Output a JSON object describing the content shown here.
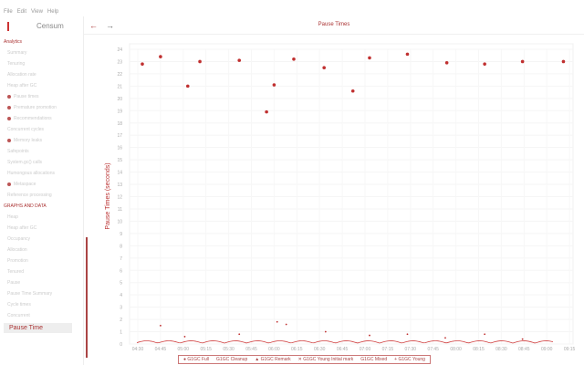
{
  "menu": [
    "File",
    "Edit",
    "View",
    "Help"
  ],
  "sidebar": {
    "brand": "Censum",
    "section1": "Analytics",
    "items1": [
      "Summary",
      "Tenuring",
      "Allocation rate",
      "Heap after GC",
      "Pause times",
      "Premature promotion",
      "Recommendations",
      "Concurrent cycles",
      "Memory leaks",
      "Safepoints",
      "System.gc() calls",
      "Humongous allocations",
      "Metaspace",
      "Reference processing"
    ],
    "section2": "GRAPHS AND DATA",
    "items2": [
      "Heap",
      "Heap after GC",
      "Occupancy",
      "Allocation",
      "Promotion",
      "Tenured",
      "Pause",
      "Pause Time Summary",
      "Cycle times",
      "Concurrent"
    ],
    "selected": "Pause Time"
  },
  "toolbar": {
    "back": "←",
    "forward": "→"
  },
  "chart_data": {
    "type": "scatter",
    "title": "Pause Times",
    "xlabel": "",
    "ylabel": "Pause Times (seconds)",
    "ylim": [
      0,
      24
    ],
    "yticks": [
      0,
      1,
      2,
      3,
      4,
      5,
      6,
      7,
      8,
      9,
      10,
      11,
      12,
      13,
      14,
      15,
      16,
      17,
      18,
      19,
      20,
      21,
      22,
      23,
      24
    ],
    "xticks": [
      "04:30",
      "04:45",
      "05:00",
      "05:15",
      "05:30",
      "05:45",
      "06:00",
      "06:15",
      "06:30",
      "06:45",
      "07:00",
      "07:15",
      "07:30",
      "07:45",
      "08:00",
      "08:15",
      "08:30",
      "08:45",
      "09:00",
      "09:15"
    ],
    "xlim_minutes": [
      270,
      555
    ],
    "legend": [
      "G1GC Full",
      "G1GC Cleanup",
      "G1GC Remark",
      "G1GC Young Initial mark",
      "G1GC Mixed",
      "G1GC Young"
    ],
    "series": [
      {
        "name": "G1GC Full",
        "color": "#c03030",
        "x": [
          273,
          285,
          303,
          311,
          337,
          355,
          360,
          373,
          393,
          412,
          423,
          448,
          474,
          499,
          524,
          551
        ],
        "y": [
          22.8,
          23.4,
          21.0,
          23.0,
          23.1,
          18.9,
          21.1,
          23.2,
          22.5,
          20.6,
          23.3,
          23.6,
          22.9,
          22.8,
          23.0,
          23.0
        ]
      },
      {
        "name": "G1GC Remark",
        "color": "#c03030",
        "x": [
          285,
          301,
          337,
          362,
          368,
          394,
          423,
          448,
          473,
          499,
          524
        ],
        "y": [
          1.5,
          0.6,
          0.8,
          1.8,
          1.6,
          1.0,
          0.7,
          0.8,
          0.5,
          0.8,
          0.4
        ]
      }
    ]
  }
}
